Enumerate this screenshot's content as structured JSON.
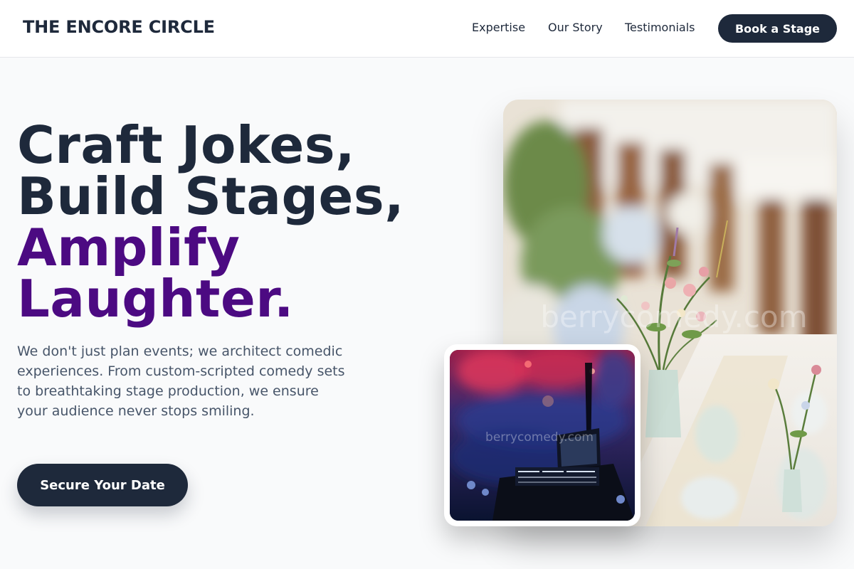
{
  "header": {
    "logo": "THE ENCORE CIRCLE",
    "nav": [
      "Expertise",
      "Our Story",
      "Testimonials"
    ],
    "cta_label": "Book a Stage"
  },
  "hero": {
    "headline_lines": [
      "Craft Jokes,",
      "Build Stages,"
    ],
    "headline_accent_lines": [
      "Amplify",
      "Laughter."
    ],
    "subtext": "We don't just plan events; we architect comedic experiences. From custom-scripted comedy sets to breathtaking stage production, we ensure your audience never stops smiling.",
    "cta_label": "Secure Your Date"
  },
  "images": {
    "main_watermark": "berrycomedy.com",
    "inset_watermark": "berrycomedy.com"
  },
  "colors": {
    "primary_dark": "#1e293b",
    "accent_purple": "#4c0a82",
    "body_text": "#475569",
    "page_background": "#f9fafb"
  }
}
